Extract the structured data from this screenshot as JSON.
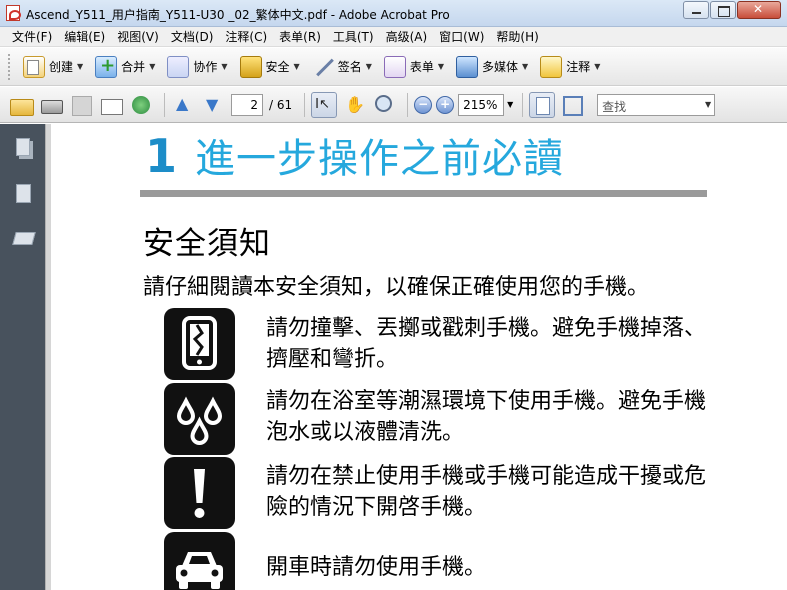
{
  "window": {
    "title": "Ascend_Y511_用户指南_Y511-U30 _02_繁体中文.pdf - Adobe Acrobat Pro"
  },
  "menu": [
    "文件(F)",
    "编辑(E)",
    "视图(V)",
    "文档(D)",
    "注释(C)",
    "表单(R)",
    "工具(T)",
    "高级(A)",
    "窗口(W)",
    "帮助(H)"
  ],
  "tasks": {
    "create": "创建",
    "combine": "合并",
    "collaborate": "协作",
    "secure": "安全",
    "sign": "签名",
    "forms": "表单",
    "multimedia": "多媒体",
    "comment": "注释"
  },
  "nav": {
    "current_page": "2",
    "total_pages": "/ 61",
    "zoom": "215%",
    "search_placeholder": "查找"
  },
  "document": {
    "chapter_number": "1",
    "chapter_title": "進一步操作之前必讀",
    "section_heading": "安全須知",
    "intro": "請仔細閱讀本安全須知，以確保正確使用您的手機。",
    "items": [
      {
        "icon": "cracked-phone-icon",
        "text": "請勿撞擊、丟擲或戳刺手機。避免手機掉落、擠壓和彎折。"
      },
      {
        "icon": "water-drops-icon",
        "text": "請勿在浴室等潮濕環境下使用手機。避免手機泡水或以液體清洗。"
      },
      {
        "icon": "exclamation-icon",
        "text": "請勿在禁止使用手機或手機可能造成干擾或危險的情況下開啓手機。"
      },
      {
        "icon": "car-icon",
        "text": "開車時請勿使用手機。"
      }
    ]
  },
  "colors": {
    "chapter_accent": "#25a8dd",
    "rule": "#9a9a9a",
    "nav_pane": "#48525d"
  }
}
